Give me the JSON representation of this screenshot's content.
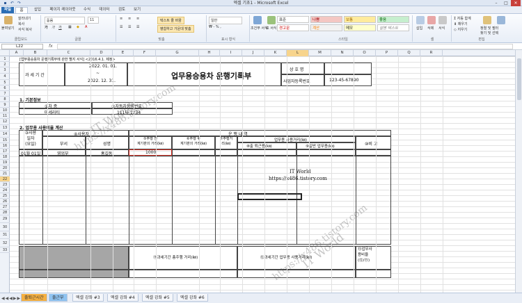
{
  "window": {
    "title": "엑셀 기초1 - Microsoft Excel",
    "quick_access": [
      "save-icon",
      "undo-icon",
      "redo-icon"
    ]
  },
  "ribbon_tabs": [
    "파일",
    "홈",
    "삽입",
    "페이지 레이아웃",
    "수식",
    "데이터",
    "검토",
    "보기"
  ],
  "ribbon": {
    "clipboard": {
      "paste": "붙여넣기",
      "cut": "잘라내기",
      "copy": "복사",
      "format_painter": "서식 복사",
      "label": "클립보드"
    },
    "font": {
      "name": "돋움",
      "size": "11",
      "label": "글꼴"
    },
    "alignment": {
      "wrap": "텍스트 줄 바꿈",
      "merge": "병합하고 가운데 맞춤",
      "label": "맞춤"
    },
    "number": {
      "format": "일반",
      "label": "표시 형식"
    },
    "styles": {
      "conditional": "조건부 서식",
      "table": "표 서식",
      "items": [
        "표준",
        "나쁨",
        "보통",
        "좋음",
        "경고문",
        "계산",
        "메모",
        "설명 텍스트"
      ],
      "label": "스타일"
    },
    "cells": {
      "insert": "삽입",
      "delete": "삭제",
      "format": "서식",
      "label": "셀"
    },
    "editing": {
      "autosum": "자동 합계",
      "fill": "채우기",
      "clear": "지우기",
      "sort": "정렬 및 필터",
      "find": "찾기 및 선택",
      "label": "편집"
    }
  },
  "formula_bar": {
    "name_box": "L22",
    "fx": "fx",
    "content": ""
  },
  "columns": [
    "A",
    "B",
    "C",
    "D",
    "E",
    "F",
    "G",
    "H",
    "I",
    "J",
    "K",
    "L",
    "M",
    "N",
    "O",
    "P",
    "Q",
    "R"
  ],
  "selected_column": "L",
  "rows": [
    "1",
    "2",
    "3",
    "4",
    "5",
    "6",
    "7",
    "8",
    "9",
    "10",
    "11",
    "12",
    "13",
    "14",
    "15",
    "16",
    "17",
    "18",
    "19",
    "20",
    "21",
    "22",
    "23",
    "24",
    "25",
    "26",
    "27",
    "28",
    "29",
    "30",
    "31",
    "32",
    "33"
  ],
  "selected_row": "22",
  "form": {
    "caption": "[업무용승용차 운행기록부에 관한 별지 서식] <2016.4.1. 제정>",
    "period_label": "과 세 기 간",
    "period_start": "2022. 01. 01.",
    "period_tilde": "~",
    "period_end": "2022.  12.  31.",
    "main_title": "업무용승용차 운행기록부",
    "company_label": "상  호  명",
    "bizno_label": "사업자등록번호",
    "bizno_value": "123-45-67890",
    "section1": "1. 기본정보",
    "car_type_label": "①차 종",
    "car_reg_label": "②자동차등록번호",
    "car_type_value": "마세라티",
    "car_reg_value": "111다 1234",
    "section2": "2. 업무용 사용비율 계산",
    "usage_date": "③사용\n일자\n(요일)",
    "user_label": "④사용자",
    "dept": "부서",
    "name": "성명",
    "drive_header": "운  행  내  역",
    "before_km": "⑤주행 전\n계기판의 거리(㎞)",
    "after_km": "⑥주행 후\n계기판의 거리(㎞)",
    "drive_km": "⑦주행거\n리(㎞)",
    "business_km": "업무용 사용거리(㎞)",
    "commute": "⑧출 퇴근용(㎞)",
    "general": "⑨일반 업무용(㎞)",
    "remark": "⑩비 고",
    "row15_date": "01월 01일",
    "row15_dept": "영업부",
    "row15_name": "홍길동",
    "row15_before": "1000",
    "total_drive": "⑪과세기간 총주행 거리(㎞)",
    "total_business": "⑫과세기간 업무용 사용거리(㎞)",
    "business_ratio": "⑬업무사\n용비율\n(⑫/⑪)",
    "site_name": "IT World",
    "site_url": "https://x486.tistory.com"
  },
  "watermarks": [
    "IT World",
    "https://x486.tistory.com",
    "IT World",
    "https://x486.tistory.com"
  ],
  "sheet_tabs": [
    "출퇴근시간",
    "출근부",
    "엑셀 강좌 #3",
    "엑셀 강좌 #4",
    "엑셀 강좌 #5",
    "엑셀 강좌 #6"
  ],
  "colors": {
    "accent": "#2a6db5",
    "selection": "#f7d48c",
    "red_border": "#d93025"
  }
}
